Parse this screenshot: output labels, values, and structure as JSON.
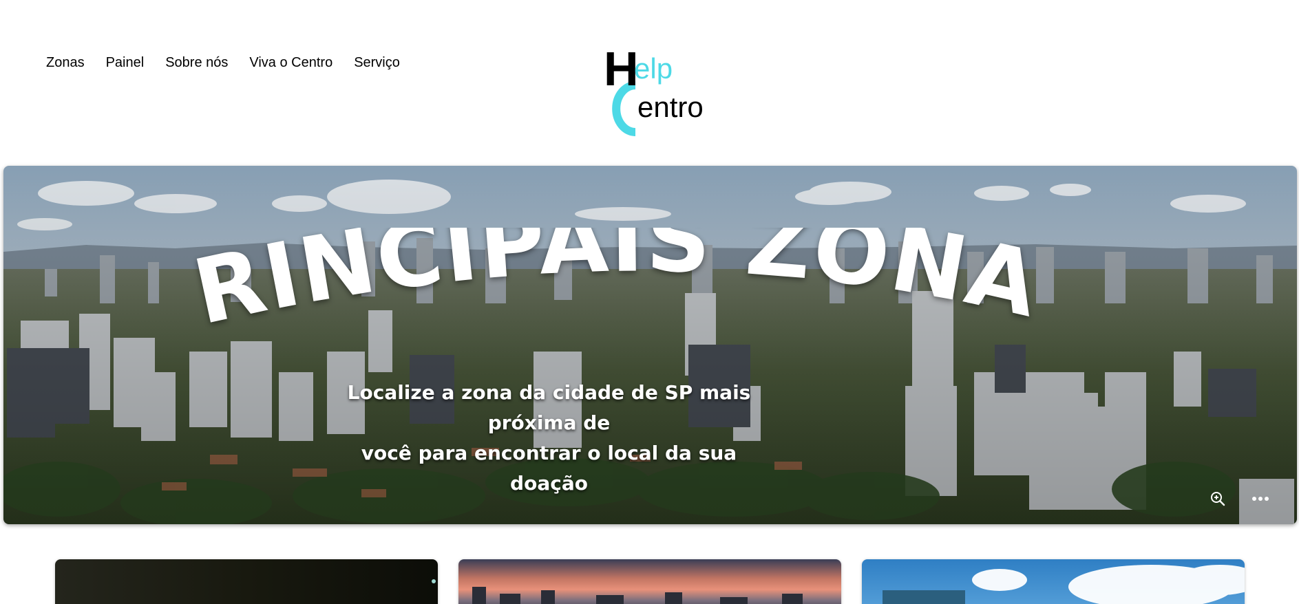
{
  "nav": {
    "items": [
      "Zonas",
      "Painel",
      "Sobre nós",
      "Viva o Centro",
      "Serviço"
    ]
  },
  "logo": {
    "line1_initial": "H",
    "line1_rest": "elp",
    "line2_initial": "C",
    "line2_rest": "entro"
  },
  "hero": {
    "title": "PRINCIPAIS ZONAS",
    "subtitle_line1": "Localize a zona da cidade de SP mais próxima de",
    "subtitle_line2": "você para encontrar  o local da sua doação",
    "tools": [
      "zoom-icon",
      "more-icon"
    ]
  },
  "colors": {
    "accent": "#4dd9e6",
    "text": "#000000",
    "hero_text": "#ffffff"
  },
  "cards": [
    {
      "name": "card-zone-1"
    },
    {
      "name": "card-zone-2"
    },
    {
      "name": "card-zone-3"
    }
  ]
}
